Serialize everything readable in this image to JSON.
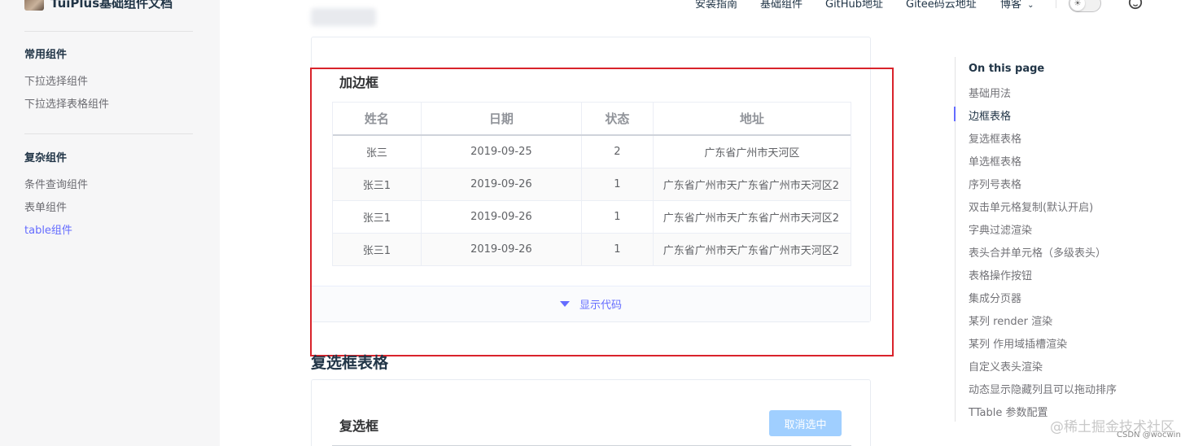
{
  "brand": {
    "title": "TuiPlus基础组件文档"
  },
  "nav": {
    "items": [
      "安装指南",
      "基础组件",
      "GitHub地址",
      "Gitee码云地址",
      "博客"
    ],
    "dropdown_icon": "chevron-down-icon"
  },
  "sidebar": {
    "groups": [
      {
        "title": "常用组件",
        "items": [
          "下拉选择组件",
          "下拉选择表格组件"
        ]
      },
      {
        "title": "复杂组件",
        "items": [
          "条件查询组件",
          "表单组件",
          "table组件"
        ]
      }
    ]
  },
  "demo1": {
    "title": "加边框",
    "columns": [
      "姓名",
      "日期",
      "状态",
      "地址"
    ],
    "rows": [
      [
        "张三",
        "2019-09-25",
        "2",
        "广东省广州市天河区"
      ],
      [
        "张三1",
        "2019-09-26",
        "1",
        "广东省广州市天广东省广州市天河区2"
      ],
      [
        "张三1",
        "2019-09-26",
        "1",
        "广东省广州市天广东省广州市天河区2"
      ],
      [
        "张三1",
        "2019-09-26",
        "1",
        "广东省广州市天广东省广州市天河区2"
      ]
    ],
    "show_code": "显示代码"
  },
  "section2": {
    "heading": "复选框表格",
    "demo_title": "复选框",
    "cancel_button": "取消选中"
  },
  "outline": {
    "title": "On this page",
    "items": [
      "基础用法",
      "边框表格",
      "复选框表格",
      "单选框表格",
      "序列号表格",
      "双击单元格复制(默认开启)",
      "字典过滤渲染",
      "表头合并单元格（多级表头）",
      "表格操作按钮",
      "集成分页器",
      "某列 render 渲染",
      "某列 作用域插槽渲染",
      "自定义表头渲染",
      "动态显示隐藏列且可以拖动排序",
      "TTable 参数配置"
    ],
    "active_index": 1
  },
  "watermark": {
    "main": "@稀土掘金技术社区",
    "sub": "CSDN @wocwin"
  },
  "colors": {
    "accent": "#646cff",
    "annotation": "#d9232b",
    "button_disabled": "#a0cfff"
  }
}
